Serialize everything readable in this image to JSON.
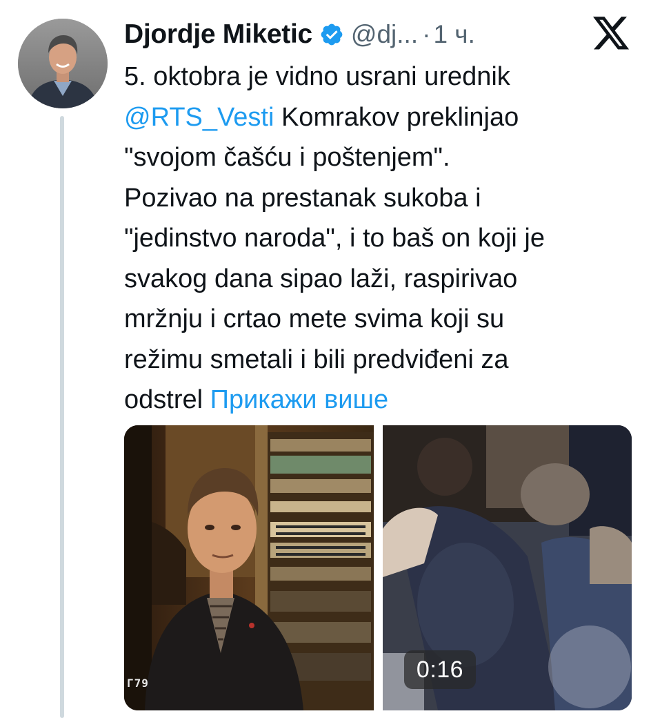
{
  "tweet": {
    "author": {
      "display_name": "Djordje Miketic",
      "handle": "@dj...",
      "verified": true,
      "avatar_icon": "person-avatar"
    },
    "separator": "·",
    "timestamp": "1 ч.",
    "platform_icon": "x-logo-icon",
    "text_lines": {
      "l1": "5. oktobra je vidno usrani urednik",
      "l2_mention": "@RTS_Vesti",
      "l2_rest": " Komrakov preklinjao",
      "l3": "\"svojom čašću i poštenjem\".",
      "l4": "Pozivao na prestanak sukoba i",
      "l5": "\"jedinstvo naroda\", i to baš on koji je",
      "l6": "svakog dana sipao laži, raspirivao",
      "l7": "mržnju i crtao mete  svima koji su",
      "l8": "režimu smetali i bili predviđeni za",
      "l9": "odstrel "
    },
    "show_more": "Прикажи више",
    "media": {
      "left_corner_mark": "Г79",
      "video_duration": "0:16"
    },
    "colors": {
      "link": "#1d9bf0",
      "text": "#0f1419",
      "muted": "#536471",
      "thread_line": "#cfd9de"
    }
  }
}
